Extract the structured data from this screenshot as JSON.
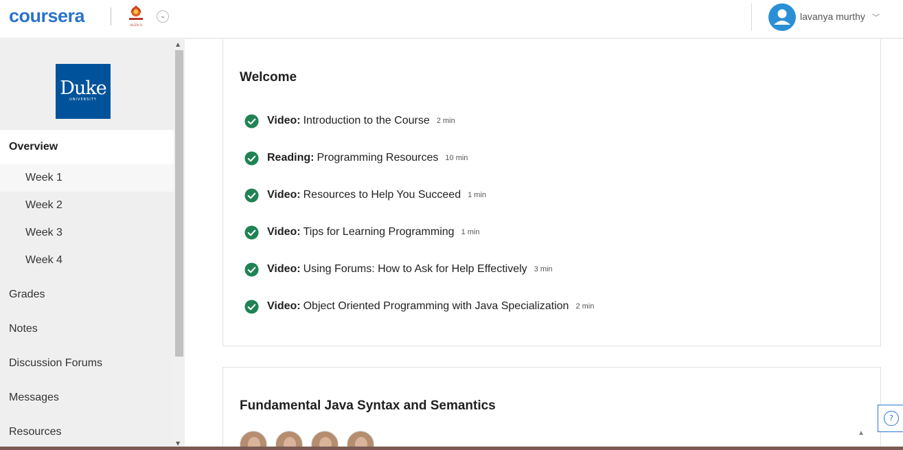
{
  "header": {
    "logo_text": "coursera",
    "partner_logo_text": "ALVA'S",
    "partner_dropdown_icon": "chevron-down-icon",
    "user_name": "lavanya murthy"
  },
  "sidebar": {
    "university_logo": {
      "word": "Duke",
      "subword": "UNIVERSITY"
    },
    "overview_label": "Overview",
    "weeks": [
      "Week 1",
      "Week 2",
      "Week 3",
      "Week 4"
    ],
    "items": [
      "Grades",
      "Notes",
      "Discussion Forums",
      "Messages",
      "Resources"
    ]
  },
  "main": {
    "sections": [
      {
        "title": "Welcome",
        "items": [
          {
            "type": "Video:",
            "title": "Introduction to the Course",
            "duration": "2 min"
          },
          {
            "type": "Reading:",
            "title": "Programming Resources",
            "duration": "10 min"
          },
          {
            "type": "Video:",
            "title": "Resources to Help You Succeed",
            "duration": "1 min"
          },
          {
            "type": "Video:",
            "title": "Tips for Learning Programming",
            "duration": "1 min"
          },
          {
            "type": "Video:",
            "title": "Using Forums: How to Ask for Help Effectively",
            "duration": "3 min"
          },
          {
            "type": "Video:",
            "title": "Object Oriented Programming with Java Specialization",
            "duration": "2 min"
          }
        ]
      },
      {
        "title": "Fundamental Java Syntax and Semantics"
      }
    ]
  },
  "help_button": {
    "label": "?"
  },
  "colors": {
    "brand": "#2a73cc",
    "completed": "#1f8354",
    "duke_blue": "#00539b"
  }
}
